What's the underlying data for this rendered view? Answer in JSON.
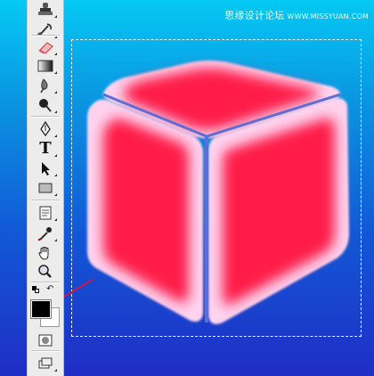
{
  "watermark": {
    "brand": "思缘设计论坛",
    "url": "WWW.MISSYUAN.COM"
  },
  "toolbar": {
    "tools": [
      {
        "name": "clone-stamp-tool",
        "icon": "stamp-icon"
      },
      {
        "name": "history-brush-tool",
        "icon": "history-brush-icon"
      },
      {
        "name": "eraser-tool",
        "icon": "eraser-icon"
      },
      {
        "name": "gradient-tool",
        "icon": "gradient-icon"
      },
      {
        "name": "blur-tool",
        "icon": "blur-icon"
      },
      {
        "name": "dodge-tool",
        "icon": "dodge-icon"
      },
      {
        "name": "pen-tool",
        "icon": "pen-icon"
      },
      {
        "name": "type-tool",
        "icon": "type-icon",
        "label": "T"
      },
      {
        "name": "path-selection-tool",
        "icon": "path-selection-icon"
      },
      {
        "name": "rectangle-tool",
        "icon": "rectangle-icon"
      },
      {
        "name": "notes-tool",
        "icon": "notes-icon"
      },
      {
        "name": "eyedropper-tool",
        "icon": "eyedropper-icon"
      },
      {
        "name": "hand-tool",
        "icon": "hand-icon"
      },
      {
        "name": "zoom-tool",
        "icon": "zoom-icon"
      },
      {
        "name": "quick-mask-button",
        "icon": "quick-mask-icon"
      },
      {
        "name": "screen-mode-button",
        "icon": "screen-mode-icon"
      }
    ],
    "foreground_color": "#000000",
    "background_color": "#ffffff"
  },
  "document": {
    "background_gradient": [
      "#05c9f4",
      "#1f2ec6"
    ],
    "cube_color": "#ff1744",
    "cube_glow_color": "#ffd6f0",
    "seam_color": "#5a6fd8",
    "selection": "marquee"
  },
  "annotation": {
    "arrow_color": "#e8102a"
  }
}
